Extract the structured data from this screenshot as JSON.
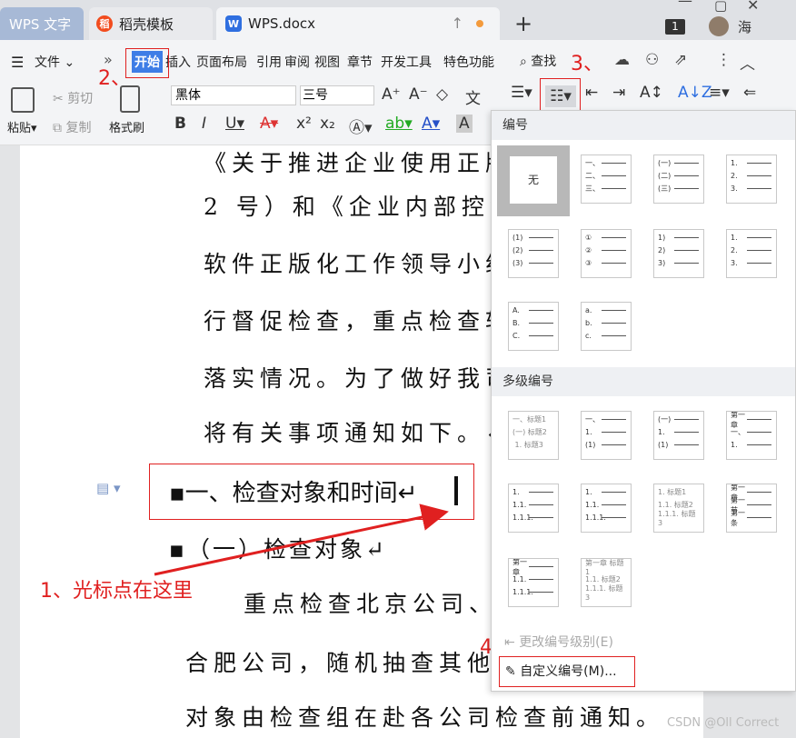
{
  "tabs": [
    {
      "label": "WPS 文字"
    },
    {
      "label": "稻壳模板"
    },
    {
      "label": "WPS.docx"
    }
  ],
  "window": {
    "badge": "1",
    "user": "海"
  },
  "menu": {
    "file": "文件",
    "start": "开始",
    "insert": "插入",
    "layout": "页面布局",
    "reference": "引用",
    "review": "审阅",
    "view": "视图",
    "section": "章节",
    "dev": "开发工具",
    "special": "特色功能",
    "search": "查找"
  },
  "toolbar": {
    "paste": "粘贴",
    "cut": "剪切",
    "copy": "复制",
    "format_painter": "格式刷",
    "font": "黑体",
    "size": "三号"
  },
  "document": {
    "lines": [
      "《关于推进企业使用正版",
      "2 号）和《企业内部控制",
      "软件正版化工作领导小组",
      "行督促检查，重点检查软",
      "落实情况。为了做好我司",
      "将有关事项通知如下。↵"
    ],
    "heading": "▪一、检查对象和时间↵",
    "subheading": "▪（一）检查对象↵",
    "body_lines": [
      "重点检查北京公司、",
      "合肥公司，随机抽查其他",
      "对象由检查组在赴各公司检查前通知。"
    ]
  },
  "annotations": {
    "step1": "1、光标点在这里",
    "step2": "2、",
    "step3": "3、",
    "step4": "4、"
  },
  "panel": {
    "numbering_title": "编号",
    "none": "无",
    "multilevel_title": "多级编号",
    "change_level": "更改编号级别(E)",
    "custom": "自定义编号(M)..."
  },
  "watermark": "CSDN @Oll Correct"
}
